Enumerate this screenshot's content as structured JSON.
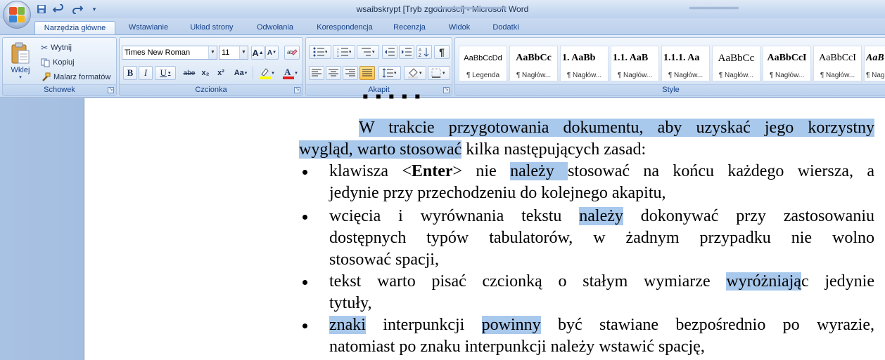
{
  "window": {
    "title": "wsaibskrypt [Tryb zgodności] - Microsoft Word"
  },
  "quick_access": {
    "icons": [
      "save-icon",
      "undo-icon",
      "redo-icon",
      "customize-icon"
    ]
  },
  "tabs": [
    {
      "label": "Narzędzia główne",
      "active": true
    },
    {
      "label": "Wstawianie"
    },
    {
      "label": "Układ strony"
    },
    {
      "label": "Odwołania"
    },
    {
      "label": "Korespondencja"
    },
    {
      "label": "Recenzja"
    },
    {
      "label": "Widok"
    },
    {
      "label": "Dodatki"
    }
  ],
  "clipboard": {
    "paste": "Wklej",
    "cut": "Wytnij",
    "copy": "Kopiuj",
    "format_painter": "Malarz formatów",
    "label": "Schowek"
  },
  "font": {
    "name": "Times New Roman",
    "size": "11",
    "label": "Czcionka",
    "buttons": [
      "B",
      "I",
      "U",
      "abe",
      "x₂",
      "x²",
      "Aa"
    ]
  },
  "paragraph": {
    "label": "Akapit",
    "pilcrow": "¶"
  },
  "styles": {
    "label": "Style",
    "items": [
      {
        "preview": "AaBbCcDd",
        "name": "¶ Legenda"
      },
      {
        "preview": "AaBbCc",
        "name": "¶ Nagłów..."
      },
      {
        "preview": "1. AaBb",
        "name": "¶ Nagłów..."
      },
      {
        "preview": "1.1. AaB",
        "name": "¶ Nagłów..."
      },
      {
        "preview": "1.1.1. Aa",
        "name": "¶ Nagłów..."
      },
      {
        "preview": "AaBbCc",
        "name": "¶ Nagłów..."
      },
      {
        "preview": "AaBbCcI",
        "name": "¶ Nagłów..."
      },
      {
        "preview": "AaBbCcI",
        "name": "¶ Nagłów..."
      },
      {
        "preview": "AaB",
        "name": "¶ Nag"
      }
    ]
  },
  "document": {
    "intro_l1_hl": "W trakcie przygotowania dokumentu, aby uzyskać jego korzystny",
    "intro_l2_hl": "wygląd, warto stosować",
    "intro_l2_rest": " kilka następujących zasad:",
    "b1": {
      "p1": "klawisza <",
      "bold": "Enter",
      "p2": "> nie ",
      "hl": "należy ",
      "p3": "stosować na końcu każdego wiersza, a",
      "l2": "jedynie przy przechodzeniu do kolejnego akapitu,"
    },
    "b2": {
      "p1": "wcięcia i wyrównania tekstu ",
      "hl": "należy",
      "p2": " dokonywać przy zastosowaniu",
      "l2": "dostępnych typów tabulatorów, w żadnym przypadku nie wolno",
      "l3": "stosować spacji,"
    },
    "b3": {
      "p1": "tekst warto pisać czcionką o stałym wymiarze ",
      "hl": "wyróżniają",
      "p2": "c jedynie",
      "l2": "tytuły,"
    },
    "b4": {
      "hl1": "znaki",
      "p1": " interpunkcji ",
      "hl2": "powinny",
      "p2": " być stawiane bezpośrednio po wyrazie,",
      "l2": "natomiast po znaku interpunkcji należy wstawić spację,"
    }
  },
  "colors": {
    "ribbon": "#dbe6f4",
    "accent": "#15428b",
    "highlight": "#a8c8ec"
  }
}
